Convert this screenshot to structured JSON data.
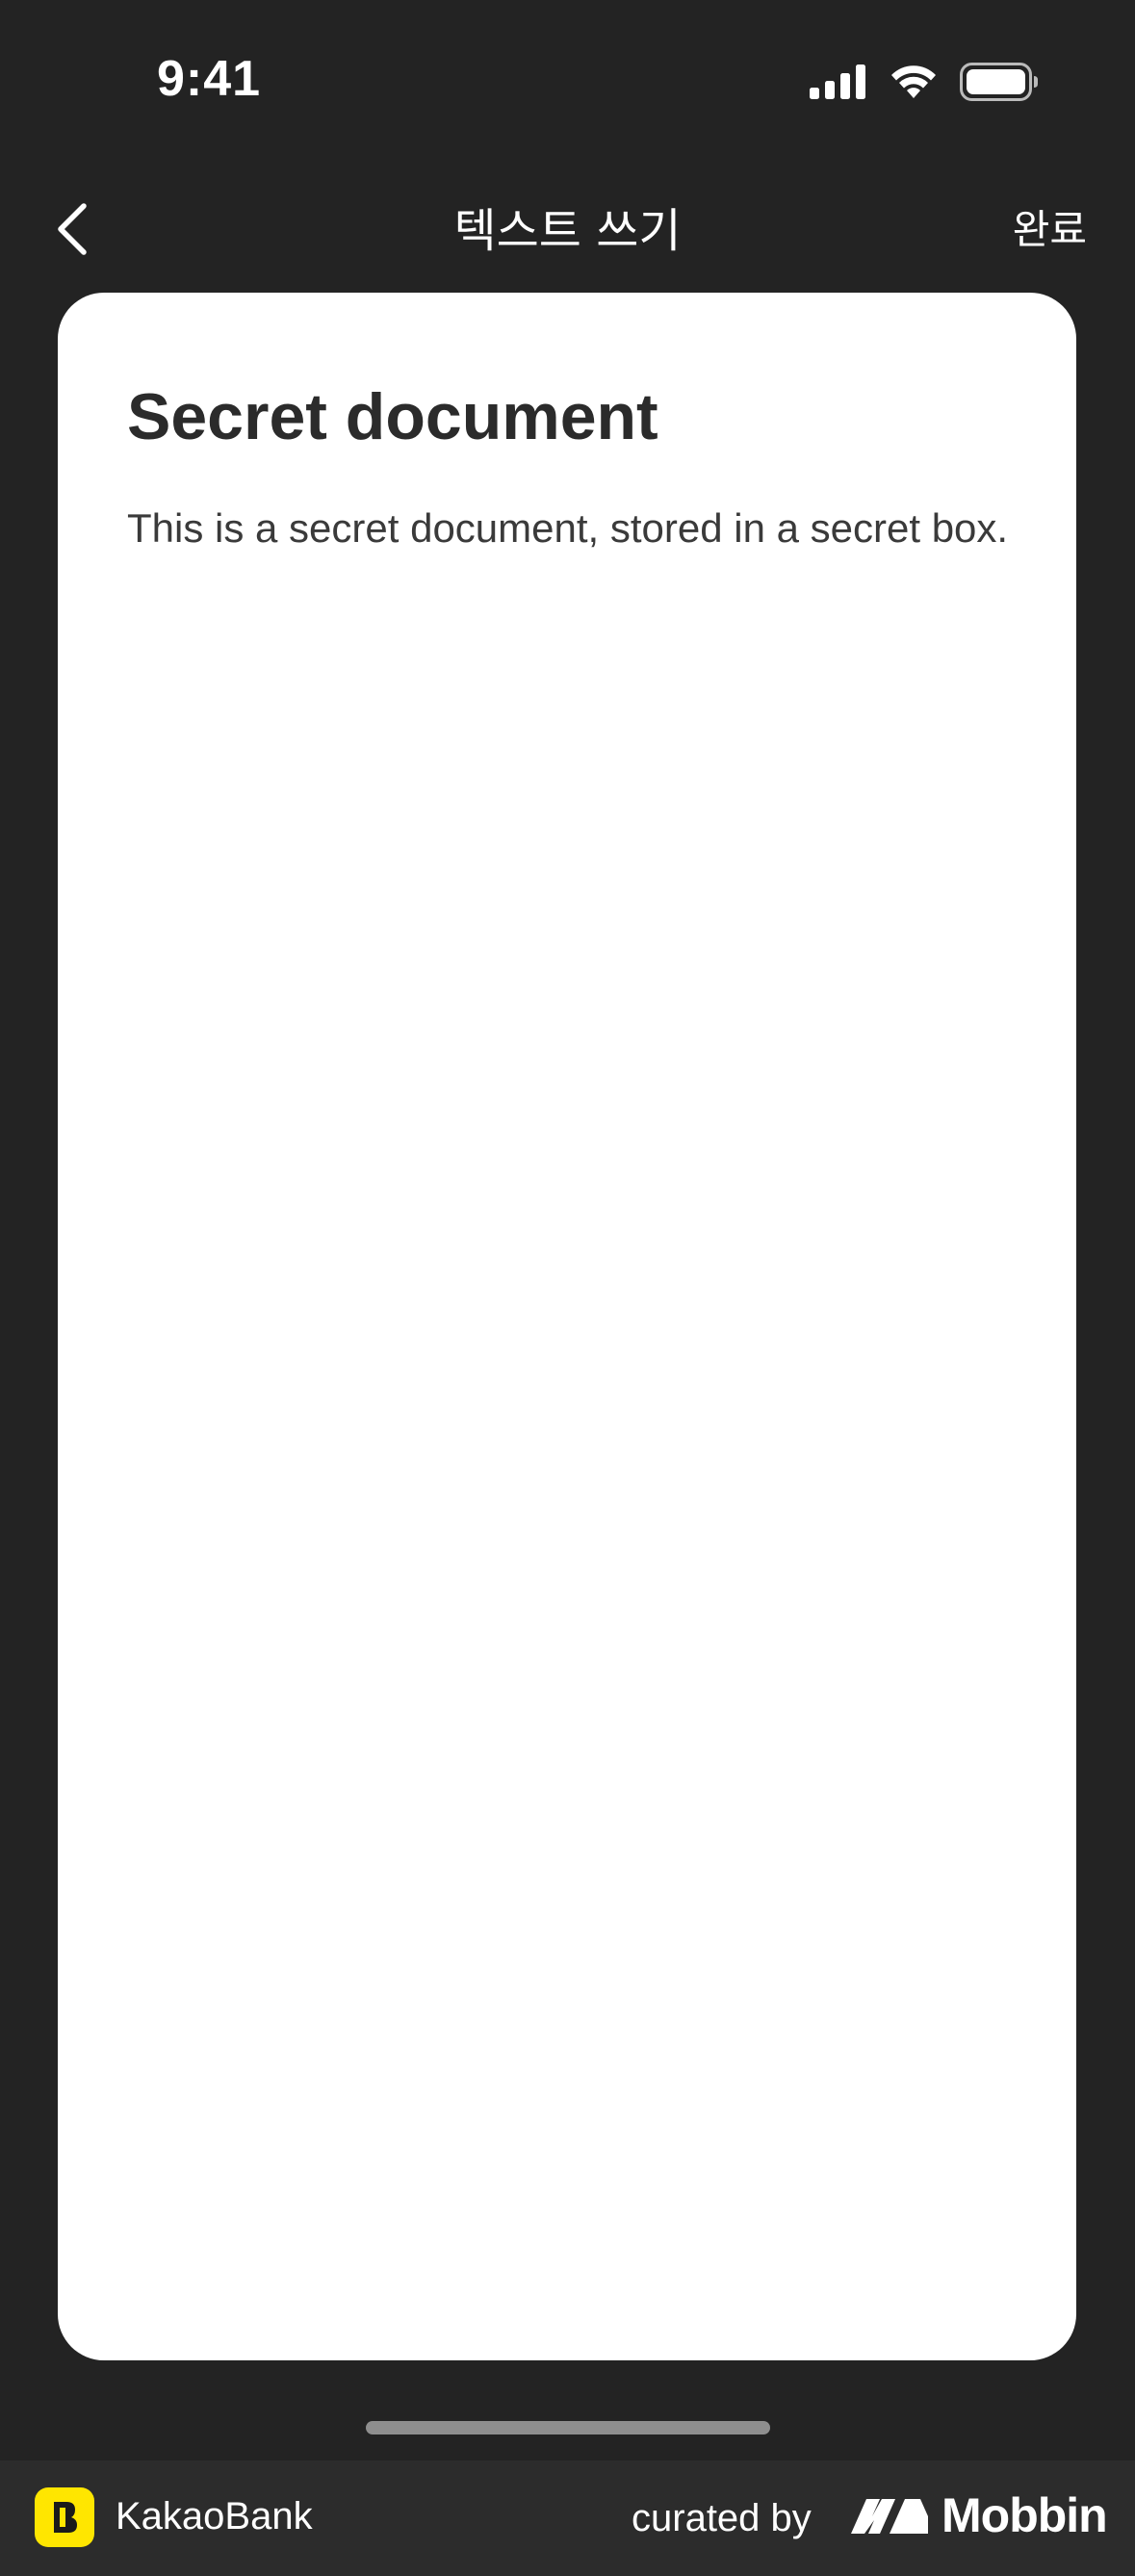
{
  "status_bar": {
    "time": "9:41",
    "signal_icon": "cellular-signal-icon",
    "wifi_icon": "wifi-icon",
    "battery_icon": "battery-icon"
  },
  "nav": {
    "back_icon": "chevron-left-icon",
    "title": "텍스트 쓰기",
    "done_label": "완료"
  },
  "document": {
    "title": "Secret document",
    "body": "This is a secret document, stored in a secret box."
  },
  "footer": {
    "app_name": "KakaoBank",
    "curated_by": "curated by",
    "curator_name": "Mobbin",
    "brand_color": "#FFE600"
  },
  "colors": {
    "background": "#232323",
    "card": "#FFFFFF",
    "text_dark": "#2B2B2B"
  }
}
